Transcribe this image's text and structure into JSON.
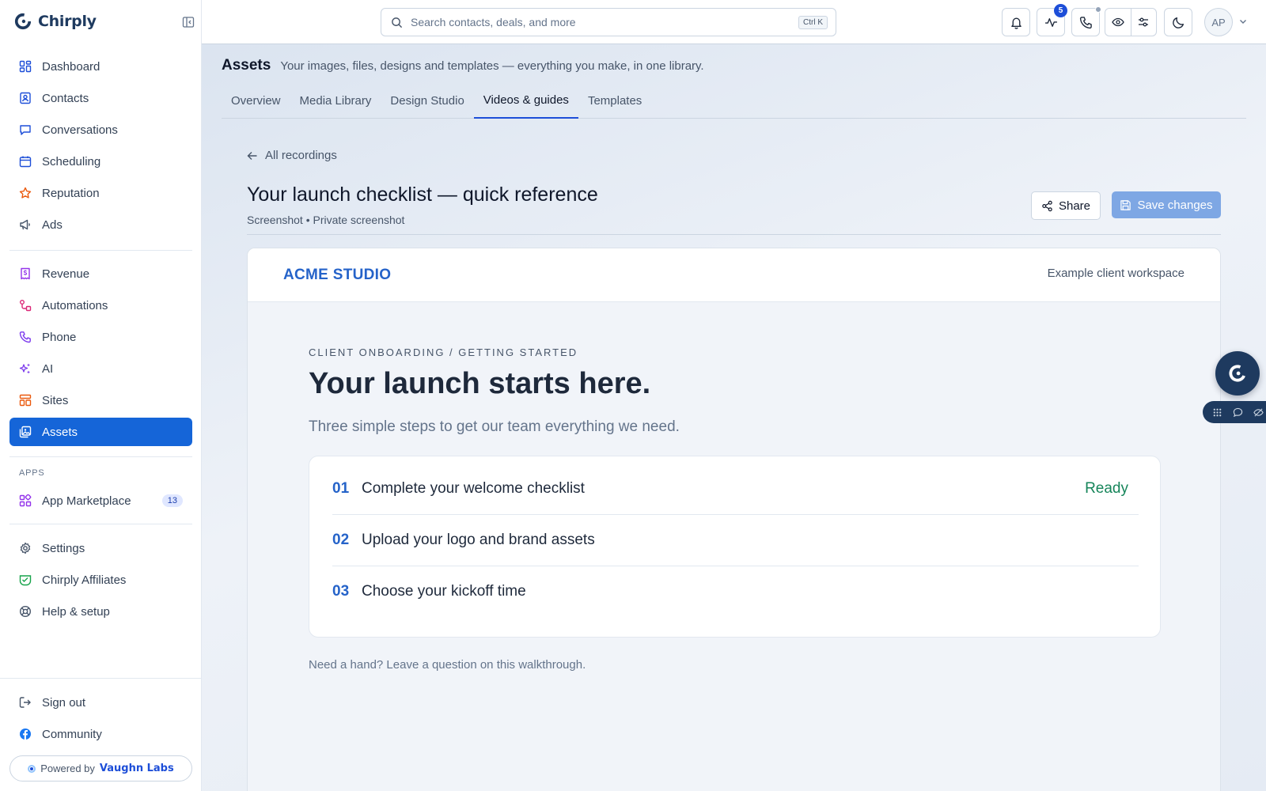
{
  "app": {
    "name": "Chirply"
  },
  "sidebar": {
    "items": [
      {
        "label": "Dashboard",
        "icon": "dashboard-icon"
      },
      {
        "label": "Contacts",
        "icon": "contacts-icon"
      },
      {
        "label": "Conversations",
        "icon": "conversations-icon"
      },
      {
        "label": "Scheduling",
        "icon": "calendar-icon"
      },
      {
        "label": "Reputation",
        "icon": "star-icon"
      },
      {
        "label": "Ads",
        "icon": "megaphone-icon"
      },
      {
        "label": "Revenue",
        "icon": "receipt-icon"
      },
      {
        "label": "Automations",
        "icon": "automations-icon"
      },
      {
        "label": "Phone",
        "icon": "phone-icon"
      },
      {
        "label": "AI",
        "icon": "sparkles-icon"
      },
      {
        "label": "Sites",
        "icon": "sites-icon"
      },
      {
        "label": "Assets",
        "icon": "assets-icon",
        "active": true
      }
    ],
    "apps_heading": "APPS",
    "marketplace": {
      "label": "App Marketplace",
      "count": "13"
    },
    "lower": [
      {
        "label": "Settings",
        "icon": "gear-icon"
      },
      {
        "label": "Chirply Affiliates",
        "icon": "handshake-icon"
      },
      {
        "label": "Help & setup",
        "icon": "lifebuoy-icon"
      }
    ],
    "bottom": [
      {
        "label": "Sign out",
        "icon": "sign-out-icon"
      },
      {
        "label": "Community",
        "icon": "facebook-icon"
      }
    ],
    "powered_by": {
      "prefix": "Powered by",
      "brand": "Vaughn Labs"
    }
  },
  "topbar": {
    "search_placeholder": "Search contacts, deals, and more",
    "shortcut": "Ctrl K",
    "activity_badge": "5",
    "avatar_initials": "AP"
  },
  "page": {
    "title": "Assets",
    "subtitle": "Your images, files, designs and templates — everything you make, in one library.",
    "tabs": [
      "Overview",
      "Media Library",
      "Design Studio",
      "Videos & guides",
      "Templates"
    ],
    "active_tab": "Videos & guides"
  },
  "recording": {
    "back_label": "All recordings",
    "title": "Your launch checklist — quick reference",
    "meta": "Screenshot • Private screenshot",
    "share_label": "Share",
    "save_label": "Save changes"
  },
  "preview": {
    "brand": "ACME STUDIO",
    "workspace": "Example client workspace",
    "eyebrow": "CLIENT ONBOARDING / GETTING STARTED",
    "headline": "Your launch starts here.",
    "subhead": "Three simple steps to get our team everything we need.",
    "steps": [
      {
        "num": "01",
        "text": "Complete your welcome checklist",
        "status": "Ready"
      },
      {
        "num": "02",
        "text": "Upload your logo and brand assets",
        "status": ""
      },
      {
        "num": "03",
        "text": "Choose your kickoff time",
        "status": ""
      }
    ],
    "help_text": "Need a hand? Leave a question on this walkthrough."
  },
  "colors": {
    "accent": "#1565d8",
    "brand_dark": "#1e3a5f",
    "ready": "#16855a",
    "save_disabled": "#7ea7e4"
  }
}
